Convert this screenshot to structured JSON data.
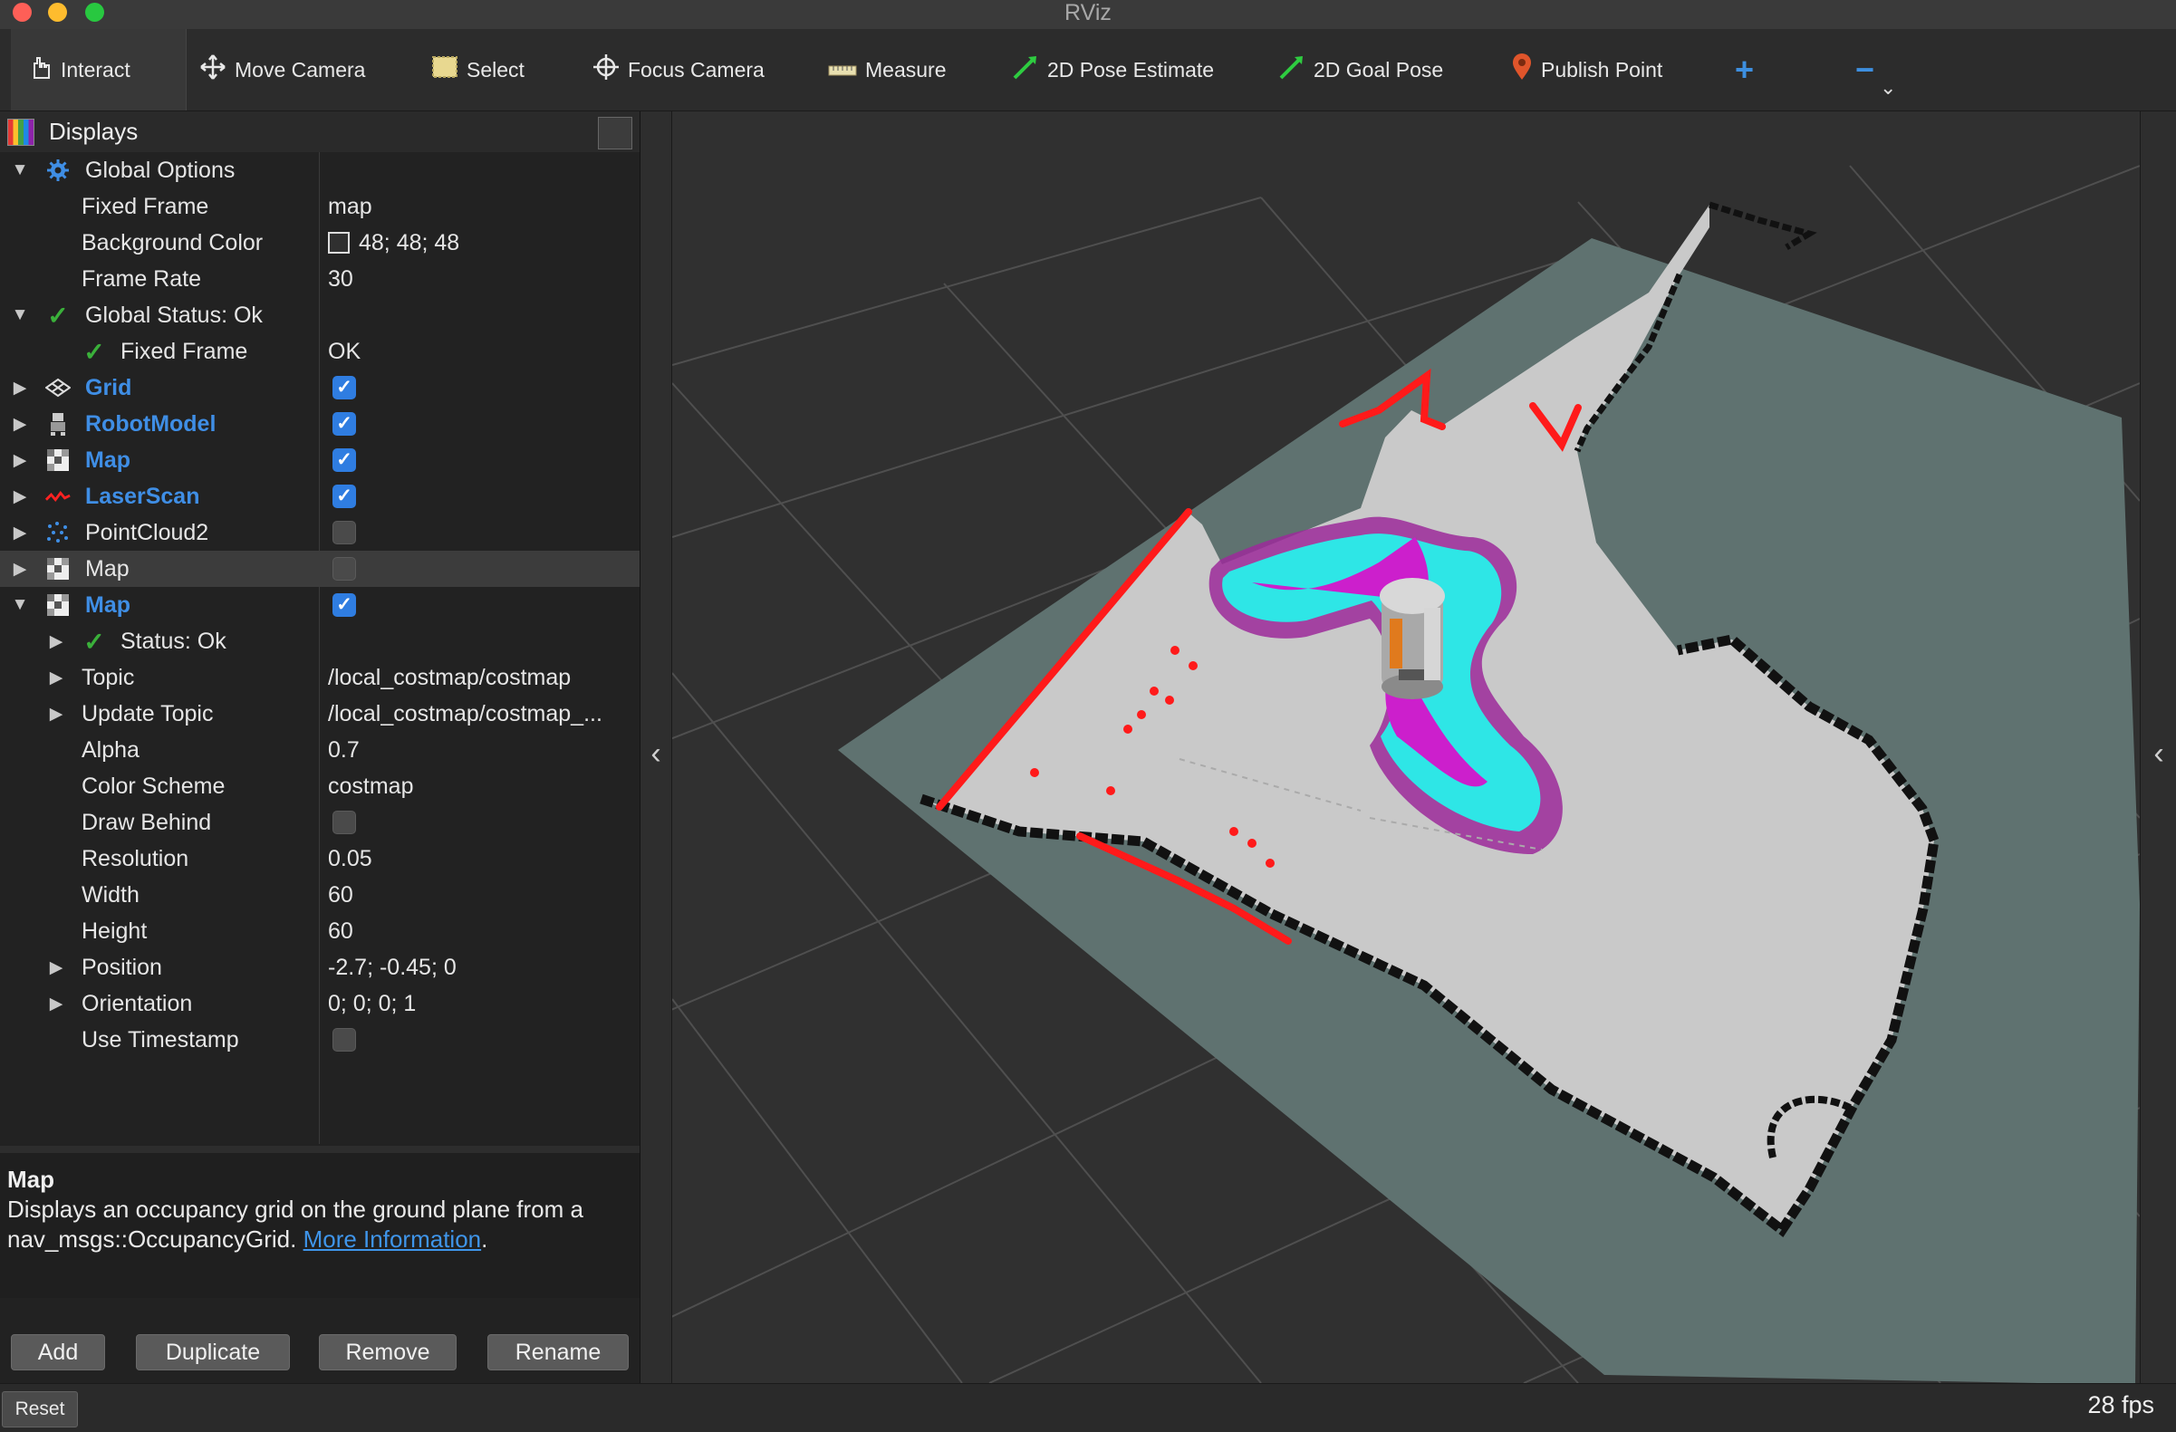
{
  "window": {
    "title": "RViz"
  },
  "toolbar": {
    "interact": "Interact",
    "move_camera": "Move Camera",
    "select": "Select",
    "focus_camera": "Focus Camera",
    "measure": "Measure",
    "pose_estimate": "2D Pose Estimate",
    "goal_pose": "2D Goal Pose",
    "publish_point": "Publish Point",
    "add_tool": "+",
    "remove_tool": "−",
    "more": "⌄"
  },
  "displays": {
    "title": "Displays",
    "rows": [
      {
        "name": "Global Options"
      },
      {
        "name": "Fixed Frame",
        "value": "map"
      },
      {
        "name": "Background Color",
        "value": "48; 48; 48"
      },
      {
        "name": "Frame Rate",
        "value": "30"
      },
      {
        "name": "Global Status: Ok"
      },
      {
        "name": "Fixed Frame",
        "value": "OK"
      },
      {
        "name": "Grid",
        "checked": true
      },
      {
        "name": "RobotModel",
        "checked": true
      },
      {
        "name": "Map",
        "checked": true
      },
      {
        "name": "LaserScan",
        "checked": true
      },
      {
        "name": "PointCloud2",
        "checked": false
      },
      {
        "name": "Map",
        "checked": false
      },
      {
        "name": "Map",
        "checked": true
      },
      {
        "name": "Status: Ok"
      },
      {
        "name": "Topic",
        "value": "/local_costmap/costmap"
      },
      {
        "name": "Update Topic",
        "value": "/local_costmap/costmap_..."
      },
      {
        "name": "Alpha",
        "value": "0.7"
      },
      {
        "name": "Color Scheme",
        "value": "costmap"
      },
      {
        "name": "Draw Behind",
        "checked": false
      },
      {
        "name": "Resolution",
        "value": "0.05"
      },
      {
        "name": "Width",
        "value": "60"
      },
      {
        "name": "Height",
        "value": "60"
      },
      {
        "name": "Position",
        "value": "-2.7; -0.45; 0"
      },
      {
        "name": "Orientation",
        "value": "0; 0; 0; 1"
      },
      {
        "name": "Use Timestamp",
        "checked": false
      }
    ]
  },
  "description": {
    "title": "Map",
    "text": "Displays an occupancy grid on the ground plane from a nav_msgs::OccupancyGrid.",
    "link": "More Information",
    "end": "."
  },
  "buttons": {
    "add": "Add",
    "duplicate": "Duplicate",
    "remove": "Remove",
    "rename": "Rename"
  },
  "status": {
    "reset": "Reset",
    "fps": "28 fps"
  },
  "colors": {
    "background": "#303030",
    "accent": "#3f8ee5",
    "laser": "#ff1a1a",
    "costmap_cyan": "#2ee6e6",
    "costmap_magenta": "#cc1fcc"
  }
}
